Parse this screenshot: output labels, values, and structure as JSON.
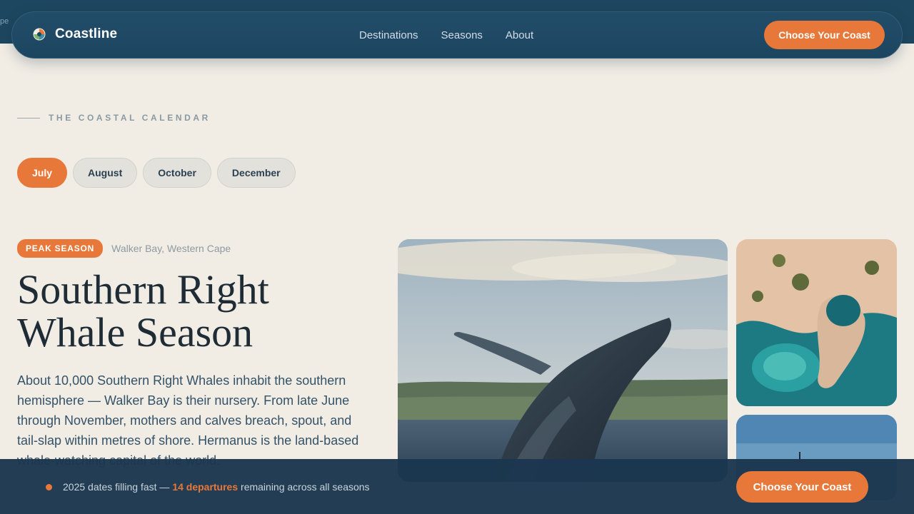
{
  "topstrip": {
    "text": "pe"
  },
  "nav": {
    "brand": "Coastline",
    "links": [
      "Destinations",
      "Seasons",
      "About"
    ],
    "cta": "Choose Your Coast"
  },
  "calendar": {
    "eyebrow": "THE COASTAL CALENDAR",
    "months": [
      "July",
      "August",
      "October",
      "December"
    ],
    "active_month": "July"
  },
  "feature": {
    "badge": "PEAK SEASON",
    "location": "Walker Bay, Western Cape",
    "title_line1": "Southern Right",
    "title_line2": "Whale Season",
    "description": "About 10,000 Southern Right Whales inhabit the southern hemisphere — Walker Bay is their nursery. From late June through November, mothers and calves breach, spout, and tail-slap within metres of shore. Hermanus is the land-based whale-watching capital of the world."
  },
  "bottom_bar": {
    "text_before": "2025 dates filling fast — ",
    "highlight": "14 departures",
    "text_after": " remaining across all seasons",
    "cta": "Choose Your Coast"
  },
  "colors": {
    "accent": "#e8783a",
    "navy": "#1d4760",
    "background": "#f1ede5"
  }
}
